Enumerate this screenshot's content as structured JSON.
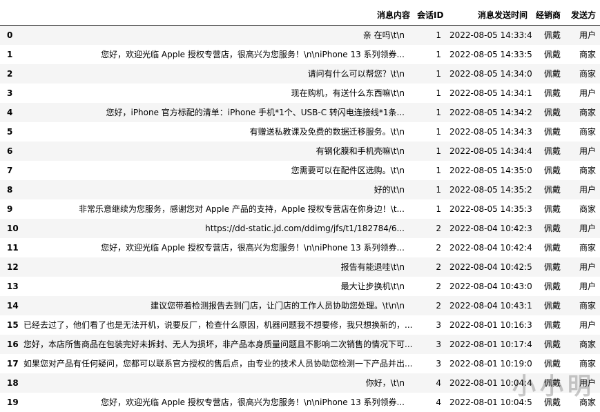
{
  "columns": [
    "",
    "消息内容",
    "会话ID",
    "消息发送时间",
    "经销商",
    "发送方"
  ],
  "rows": [
    {
      "idx": "0",
      "msg": "亲 在吗\\t\\n",
      "cid": "1",
      "time": "2022-08-05 14:33:48",
      "dealer": "佩戴",
      "sender": "用户"
    },
    {
      "idx": "1",
      "msg": "您好，欢迎光临 Apple 授权专营店，很高兴为您服务！\\n\\niPhone 13 系列领券...",
      "cid": "1",
      "time": "2022-08-05 14:33:53",
      "dealer": "佩戴",
      "sender": "商家"
    },
    {
      "idx": "2",
      "msg": "请问有什么可以帮您？\\t\\n",
      "cid": "1",
      "time": "2022-08-05 14:34:00",
      "dealer": "佩戴",
      "sender": "商家"
    },
    {
      "idx": "3",
      "msg": "现在购机，有送什么东西嘛\\t\\n",
      "cid": "1",
      "time": "2022-08-05 14:34:11",
      "dealer": "佩戴",
      "sender": "用户"
    },
    {
      "idx": "4",
      "msg": "您好，iPhone 官方标配的清单：iPhone 手机*1个、USB-C 转闪电连接线*1条...",
      "cid": "1",
      "time": "2022-08-05 14:34:22",
      "dealer": "佩戴",
      "sender": "商家"
    },
    {
      "idx": "5",
      "msg": "有赠送私教课及免费的数据迁移服务。\\t\\n",
      "cid": "1",
      "time": "2022-08-05 14:34:35",
      "dealer": "佩戴",
      "sender": "商家"
    },
    {
      "idx": "6",
      "msg": "有钢化膜和手机壳嘛\\t\\n",
      "cid": "1",
      "time": "2022-08-05 14:34:47",
      "dealer": "佩戴",
      "sender": "用户"
    },
    {
      "idx": "7",
      "msg": "您需要可以在配件区选购。\\t\\n",
      "cid": "1",
      "time": "2022-08-05 14:35:02",
      "dealer": "佩戴",
      "sender": "商家"
    },
    {
      "idx": "8",
      "msg": "好的\\t\\n",
      "cid": "1",
      "time": "2022-08-05 14:35:24",
      "dealer": "佩戴",
      "sender": "用户"
    },
    {
      "idx": "9",
      "msg": "非常乐意继续为您服务，感谢您对 Apple 产品的支持，Apple 授权专营店在你身边！\\t...",
      "cid": "1",
      "time": "2022-08-05 14:35:33",
      "dealer": "佩戴",
      "sender": "商家"
    },
    {
      "idx": "10",
      "msg": "https://dd-static.jd.com/ddimg/jfs/t1/182784/6...",
      "cid": "2",
      "time": "2022-08-04 10:42:36",
      "dealer": "佩戴",
      "sender": "用户"
    },
    {
      "idx": "11",
      "msg": "您好，欢迎光临 Apple 授权专营店，很高兴为您服务！\\n\\niPhone 13 系列领券...",
      "cid": "2",
      "time": "2022-08-04 10:42:42",
      "dealer": "佩戴",
      "sender": "商家"
    },
    {
      "idx": "12",
      "msg": "报告有能退哇\\t\\n",
      "cid": "2",
      "time": "2022-08-04 10:42:58",
      "dealer": "佩戴",
      "sender": "用户"
    },
    {
      "idx": "13",
      "msg": "最大让步换机\\t\\n",
      "cid": "2",
      "time": "2022-08-04 10:43:06",
      "dealer": "佩戴",
      "sender": "用户"
    },
    {
      "idx": "14",
      "msg": "建议您带着检测报告去到门店，让门店的工作人员协助您处理。\\t\\n\\n",
      "cid": "2",
      "time": "2022-08-04 10:43:19",
      "dealer": "佩戴",
      "sender": "商家"
    },
    {
      "idx": "15",
      "msg": "已经去过了，他们看了也是无法开机，说要反厂，检查什么原因，机器问题我不想要修，我只想换新的，...",
      "cid": "3",
      "time": "2022-08-01 10:16:38",
      "dealer": "佩戴",
      "sender": "用户"
    },
    {
      "idx": "16",
      "msg": "您好，本店所售商品在包装完好未拆封、无人为损坏，非产品本身质量问题且不影响二次销售的情况下可...",
      "cid": "3",
      "time": "2022-08-01 10:17:41",
      "dealer": "佩戴",
      "sender": "商家"
    },
    {
      "idx": "17",
      "msg": "如果您对产品有任何疑问，您都可以联系官方授权的售后点，由专业的技术人员协助您检测一下产品并出...",
      "cid": "3",
      "time": "2022-08-01 10:19:02",
      "dealer": "佩戴",
      "sender": "商家"
    },
    {
      "idx": "18",
      "msg": "你好，\\t\\n",
      "cid": "4",
      "time": "2022-08-01 10:04:48",
      "dealer": "佩戴",
      "sender": "用户"
    },
    {
      "idx": "19",
      "msg": "您好，欢迎光临 Apple 授权专营店，很高兴为您服务！\\n\\niPhone 13 系列领券...",
      "cid": "4",
      "time": "2022-08-01 10:04:56",
      "dealer": "佩戴",
      "sender": "商家"
    }
  ],
  "watermark": "小小明"
}
